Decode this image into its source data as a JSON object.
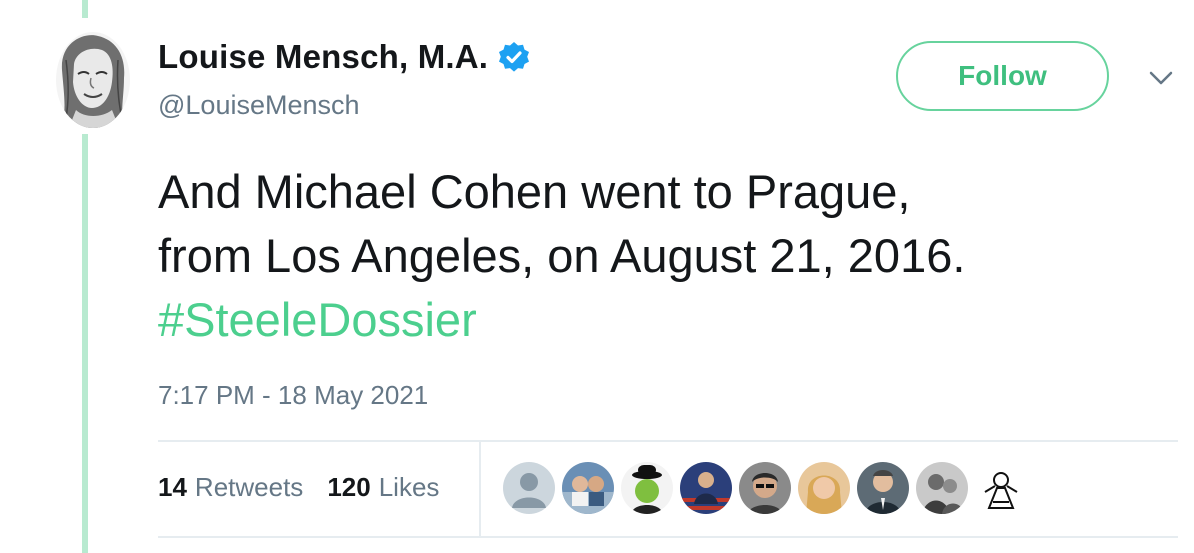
{
  "author": {
    "display_name": "Louise Mensch, M.A.",
    "handle": "@LouiseMensch",
    "verified": true,
    "avatar_icon": "sketch-portrait-avatar",
    "verified_icon": "verified-badge-icon"
  },
  "actions": {
    "follow_label": "Follow",
    "menu_icon": "chevron-down-icon"
  },
  "tweet": {
    "line1": "And Michael Cohen went to Prague,",
    "line2": "from Los Angeles, on August 21, 2016.",
    "hashtag": "#SteeleDossier",
    "timestamp": "7:17 PM - 18 May 2021"
  },
  "stats": {
    "retweets_count": "14",
    "retweets_label": "Retweets",
    "likes_count": "120",
    "likes_label": "Likes"
  },
  "likers": [
    "default-avatar",
    "couple-photo-avatar",
    "apple-bowler-hat-avatar",
    "flag-person-avatar",
    "woman-portrait-avatar",
    "blonde-woman-avatar",
    "man-suit-avatar",
    "bw-photo-avatar",
    "illustration-avatar"
  ],
  "colors": {
    "accent_green": "#4ccf8e",
    "thread_line": "#b8ead0",
    "verified_blue": "#1da1f2",
    "muted_text": "#657786"
  }
}
